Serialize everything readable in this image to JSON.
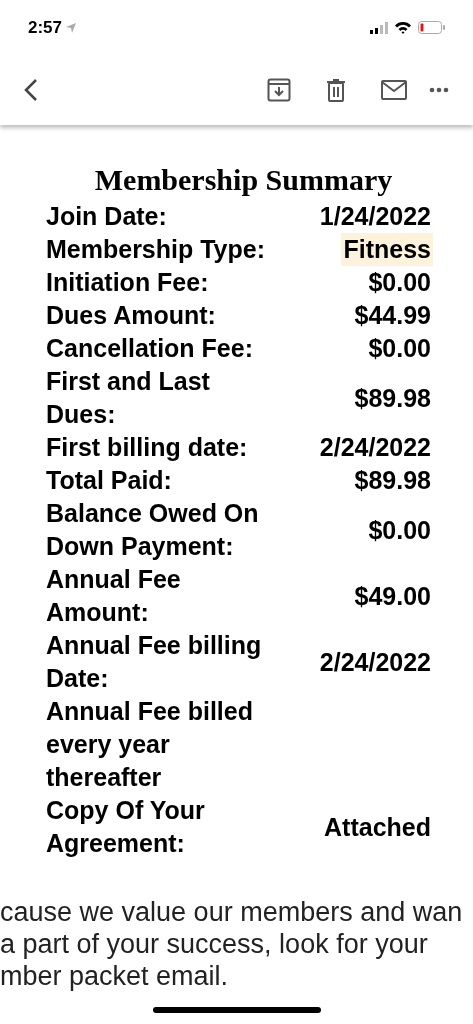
{
  "status_bar": {
    "time": "2:57"
  },
  "title": "Membership Summary",
  "rows": [
    {
      "label": "Join Date:",
      "value": "1/24/2022",
      "highlighted": false
    },
    {
      "label": "Membership Type:",
      "value": "Fitness",
      "highlighted": true
    },
    {
      "label": "Initiation Fee:",
      "value": "$0.00",
      "highlighted": false
    },
    {
      "label": "Dues Amount:",
      "value": "$44.99",
      "highlighted": false
    },
    {
      "label": "Cancellation Fee:",
      "value": "$0.00",
      "highlighted": false
    },
    {
      "label": "First and Last Dues:",
      "value": "$89.98",
      "highlighted": false
    },
    {
      "label": "First billing date:",
      "value": "2/24/2022",
      "highlighted": false
    },
    {
      "label": "Total Paid:",
      "value": "$89.98",
      "highlighted": false
    },
    {
      "label": "Balance Owed On Down Payment:",
      "value": "$0.00",
      "highlighted": false
    },
    {
      "label": "Annual Fee Amount:",
      "value": "$49.00",
      "highlighted": false
    },
    {
      "label": "Annual Fee billing Date:",
      "value": "2/24/2022",
      "highlighted": false
    },
    {
      "label": "Annual Fee billed every year thereafter",
      "highlighted": false
    },
    {
      "label": "Copy Of Your Agreement:",
      "value": "Attached",
      "highlighted": false
    }
  ],
  "footer_lines": [
    "cause we value our members and wan",
    "a part of your success, look for your",
    "mber packet email."
  ]
}
